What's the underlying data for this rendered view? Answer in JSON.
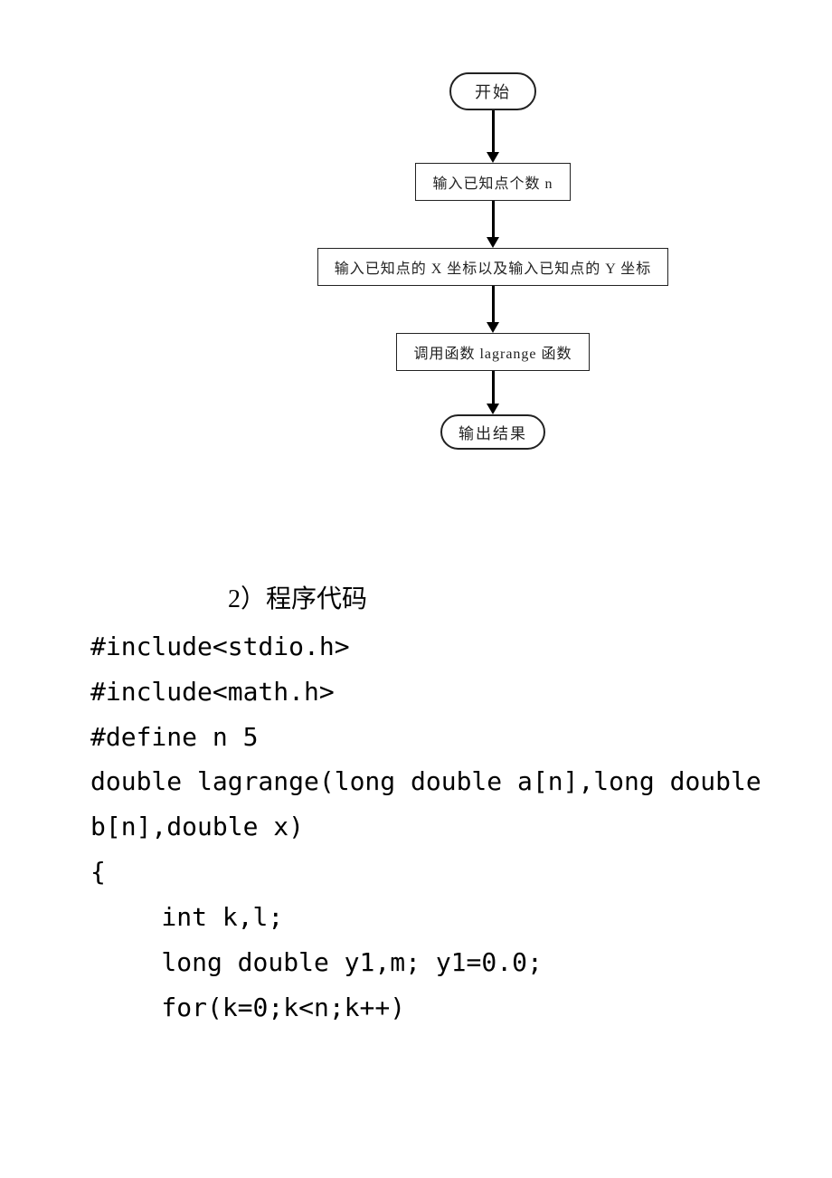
{
  "flowchart": {
    "start": "开始",
    "step1": "输入已知点个数 n",
    "step2": "输入已知点的 X 坐标以及输入已知点的 Y 坐标",
    "step3": "调用函数 lagrange 函数",
    "end": "输出结果"
  },
  "heading": "2）程序代码",
  "code": {
    "l1": "#include<stdio.h>",
    "l2": "#include<math.h>",
    "l3": "#define n 5",
    "l4": "double lagrange(long double a[n],long double",
    "l5": "b[n],double x)",
    "l6": "{",
    "l7": "int k,l;",
    "l8": "long double y1,m; y1=0.0;",
    "l9": "for(k=0;k<n;k++)"
  }
}
